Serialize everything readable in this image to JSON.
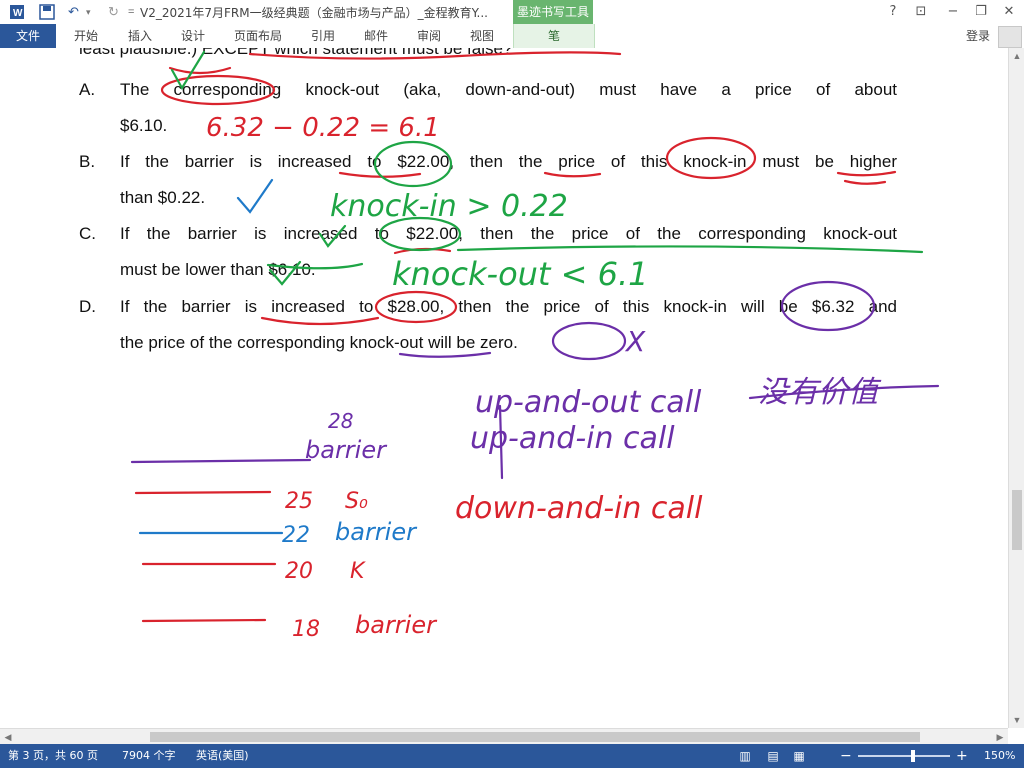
{
  "app": {
    "title": "V2_2021年7月FRM一级经典题（金融市场与产品）_金程教育Y...",
    "ink_tools_tab": "墨迹书写工具",
    "quick_access": {
      "word_icon": "word-icon",
      "save_icon": "save-icon",
      "undo_icon": "undo-icon",
      "redo_icon": "redo-icon",
      "customize": "="
    },
    "window_controls": {
      "help": "?",
      "ribbon_options": "⊡",
      "minimize": "−",
      "restore": "❐",
      "close": "✕"
    }
  },
  "ribbon": {
    "file": "文件",
    "tabs": [
      "开始",
      "插入",
      "设计",
      "页面布局",
      "引用",
      "邮件",
      "审阅",
      "视图"
    ],
    "pen_tab": "笔",
    "login": "登录"
  },
  "document": {
    "header_fragment": "least plausible.) EXCEPT which statement must be false?",
    "options": [
      {
        "letter": "A.",
        "line1": "The corresponding knock-out (aka, down-and-out) must have a price of about",
        "line2": "$6.10."
      },
      {
        "letter": "B.",
        "line1": "If the barrier is increased to $22.00, then the price of this knock-in must be higher",
        "line2": "than $0.22."
      },
      {
        "letter": "C.",
        "line1": "If the barrier is increased to $22.00, then the price of the corresponding knock-out",
        "line2": "must be lower than $6.10."
      },
      {
        "letter": "D.",
        "line1": "If the barrier is increased to $28.00, then the price of this knock-in will be $6.32 and",
        "line2": "the price of the corresponding knock-out will be zero."
      }
    ],
    "handwriting": {
      "calc": "6.32 − 0.22 = 6.1",
      "knock_in": "knock-in > 0.22",
      "knock_out": "knock-out < 6.1",
      "mark_x": "X",
      "up_out": "up-and-out call",
      "no_value": "没有价值",
      "up_in": "up-and-in call",
      "down_in": "down-and-in call",
      "ladder": {
        "n28": "28",
        "barrier1": "barrier",
        "n25": "25",
        "s0": "S₀",
        "n22": "22",
        "barrier2": "barrier",
        "n20": "20",
        "k": "K",
        "n18": "18",
        "barrier3": "barrier"
      }
    },
    "ink_colors": {
      "red": "#d9232d",
      "green": "#1ea545",
      "purple": "#6b2fa8",
      "blue": "#1f7ac9",
      "text": "#111111"
    }
  },
  "statusbar": {
    "page": "第 3 页，共 60 页",
    "words": "7904 个字",
    "language": "英语(美国)",
    "zoom": "150%",
    "zoom_level_fraction": 0.6
  }
}
